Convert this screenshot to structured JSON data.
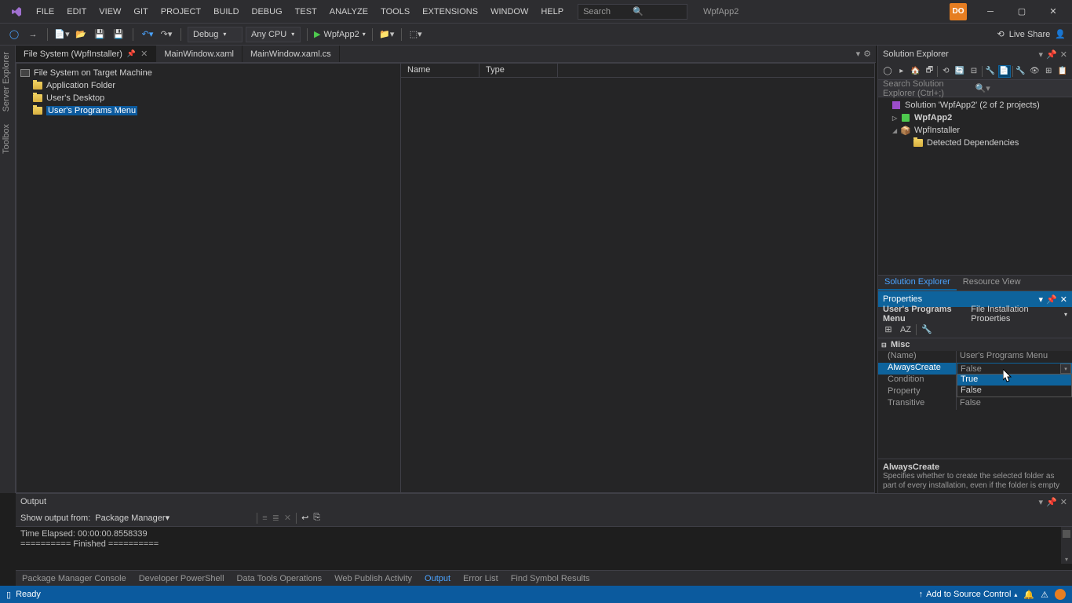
{
  "titlebar": {
    "menus": [
      "FILE",
      "EDIT",
      "VIEW",
      "GIT",
      "PROJECT",
      "BUILD",
      "DEBUG",
      "TEST",
      "ANALYZE",
      "TOOLS",
      "EXTENSIONS",
      "WINDOW",
      "HELP"
    ],
    "search_placeholder": "Search",
    "app_name": "WpfApp2",
    "user_initials": "DO"
  },
  "toolbar": {
    "config": "Debug",
    "platform": "Any CPU",
    "start_target": "WpfApp2",
    "liveshare": "Live Share"
  },
  "side_tabs": {
    "left": [
      "Server Explorer",
      "Toolbox"
    ]
  },
  "doc_tabs": {
    "tabs": [
      {
        "label": "File System (WpfInstaller)",
        "active": true,
        "pinned": true
      },
      {
        "label": "MainWindow.xaml",
        "active": false
      },
      {
        "label": "MainWindow.xaml.cs",
        "active": false
      }
    ]
  },
  "filesystem": {
    "root": "File System on Target Machine",
    "children": [
      "Application Folder",
      "User's Desktop",
      "User's Programs Menu"
    ],
    "selected": "User's Programs Menu",
    "list_headers": {
      "name": "Name",
      "type": "Type"
    }
  },
  "solution_explorer": {
    "title": "Solution Explorer",
    "search_placeholder": "Search Solution Explorer (Ctrl+;)",
    "solution_line": "Solution 'WpfApp2' (2 of 2 projects)",
    "projects": [
      {
        "name": "WpfApp2",
        "bold": true,
        "expanded": false
      },
      {
        "name": "WpfInstaller",
        "expanded": true,
        "children": [
          "Detected Dependencies"
        ]
      }
    ],
    "bottom_tabs": [
      "Solution Explorer",
      "Resource View"
    ]
  },
  "properties": {
    "title": "Properties",
    "object_name": "User's Programs Menu",
    "object_type": "File Installation Properties",
    "category": "Misc",
    "rows": [
      {
        "name": "(Name)",
        "value": "User's Programs Menu"
      },
      {
        "name": "AlwaysCreate",
        "value": "False",
        "selected": true
      },
      {
        "name": "Condition",
        "value": ""
      },
      {
        "name": "Property",
        "value": ""
      },
      {
        "name": "Transitive",
        "value": "False"
      }
    ],
    "dropdown": {
      "options": [
        "True",
        "False"
      ],
      "highlighted": "True"
    },
    "desc_name": "AlwaysCreate",
    "desc_text": "Specifies whether to create the selected folder as part of every installation, even if the folder is empty"
  },
  "output": {
    "title": "Output",
    "show_label": "Show output from:",
    "source": "Package Manager",
    "lines": [
      "Time Elapsed: 00:00:00.8558339",
      "========== Finished =========="
    ]
  },
  "bottom_tabs": [
    "Package Manager Console",
    "Developer PowerShell",
    "Data Tools Operations",
    "Web Publish Activity",
    "Output",
    "Error List",
    "Find Symbol Results"
  ],
  "bottom_active": "Output",
  "statusbar": {
    "ready": "Ready",
    "source_control": "Add to Source Control"
  }
}
